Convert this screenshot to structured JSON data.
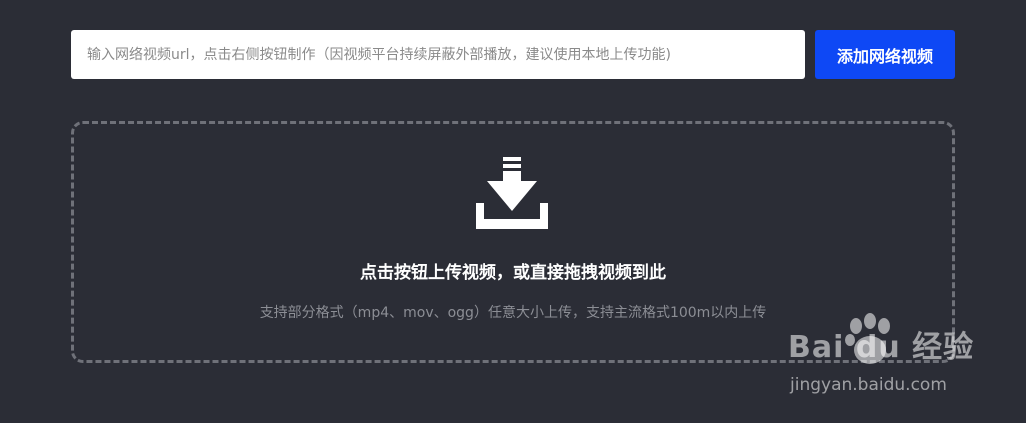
{
  "url_input": {
    "placeholder": "输入网络视频url，点击右侧按钮制作（因视频平台持续屏蔽外部播放，建议使用本地上传功能)",
    "value": ""
  },
  "add_button": {
    "label": "添加网络视频"
  },
  "upload_area": {
    "icon": "download-tray-icon",
    "title": "点击按钮上传视频，或直接拖拽视频到此",
    "hint": "支持部分格式（mp4、mov、ogg）任意大小上传，支持主流格式100m以内上传"
  },
  "watermark": {
    "brand": "Bai du 经验",
    "url": "jingyan.baidu.com"
  },
  "colors": {
    "background": "#2b2d36",
    "accent": "#0e48f5",
    "dashed_border": "#6f7179"
  }
}
